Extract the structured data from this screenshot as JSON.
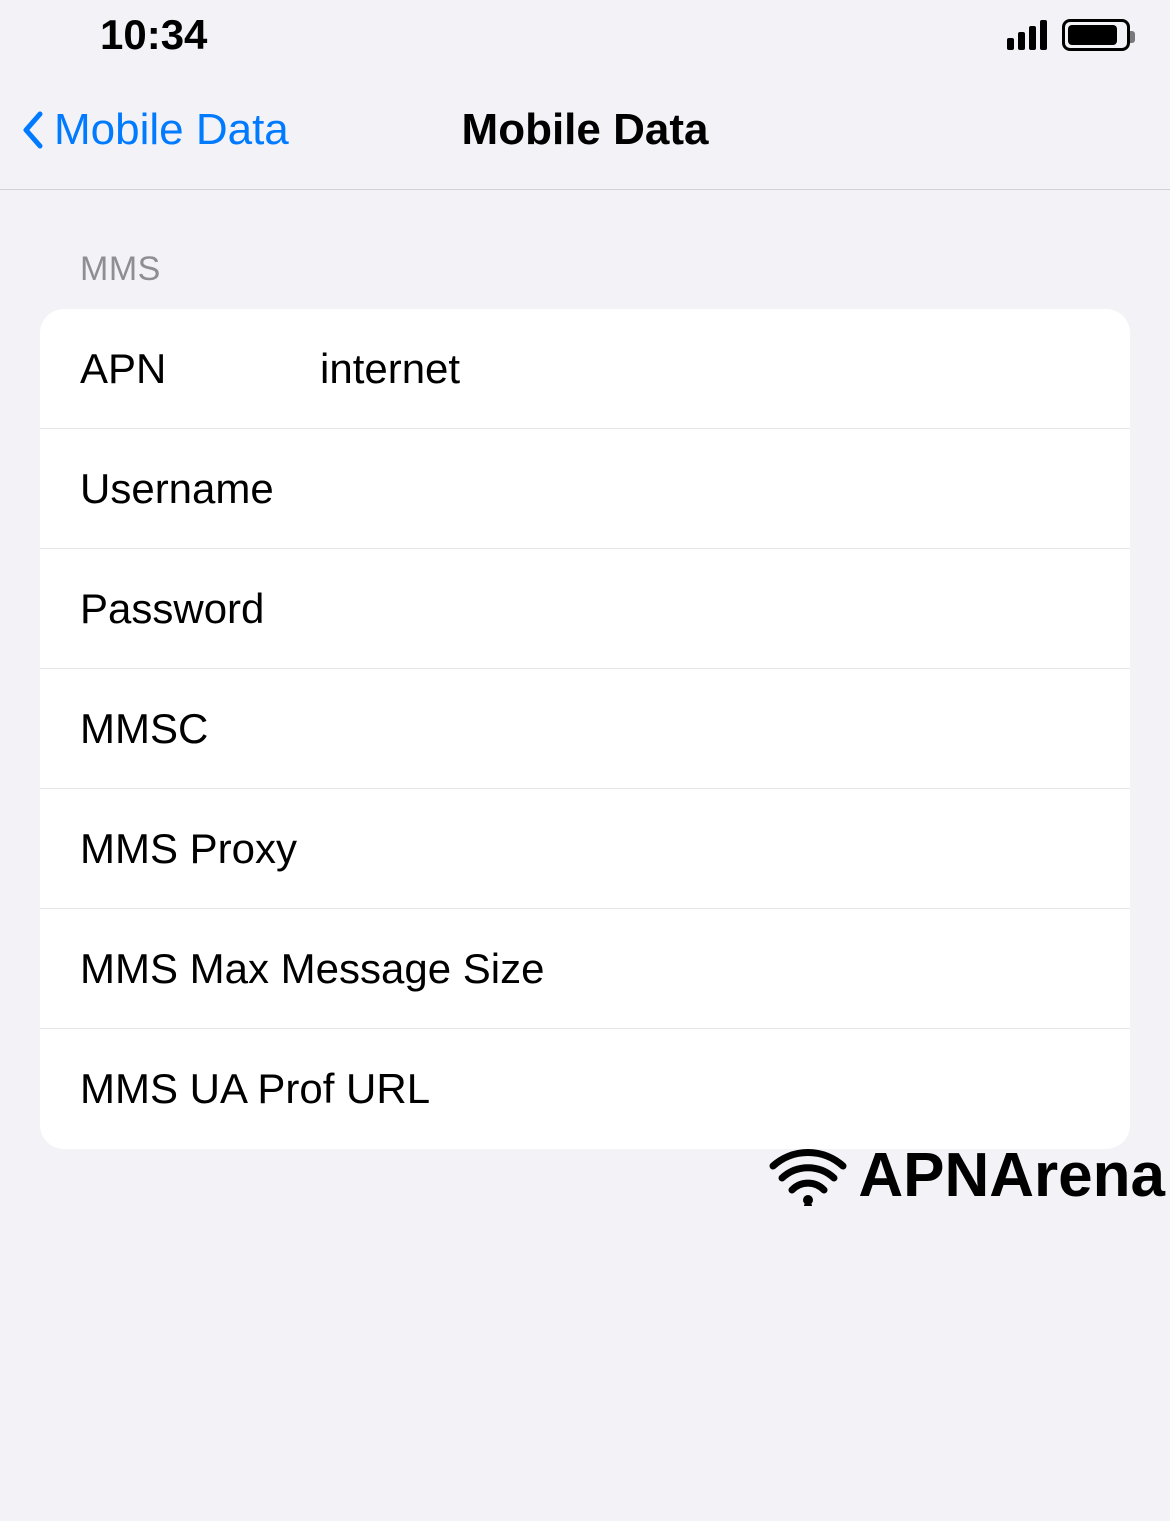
{
  "status_bar": {
    "time": "10:34"
  },
  "nav": {
    "back_label": "Mobile Data",
    "title": "Mobile Data"
  },
  "section_header": "MMS",
  "fields": {
    "apn": {
      "label": "APN",
      "value": "internet"
    },
    "username": {
      "label": "Username",
      "value": ""
    },
    "password": {
      "label": "Password",
      "value": ""
    },
    "mmsc": {
      "label": "MMSC",
      "value": ""
    },
    "mms_proxy": {
      "label": "MMS Proxy",
      "value": ""
    },
    "mms_max_size": {
      "label": "MMS Max Message Size",
      "value": ""
    },
    "mms_ua_prof": {
      "label": "MMS UA Prof URL",
      "value": ""
    }
  },
  "watermark": "APNArena"
}
